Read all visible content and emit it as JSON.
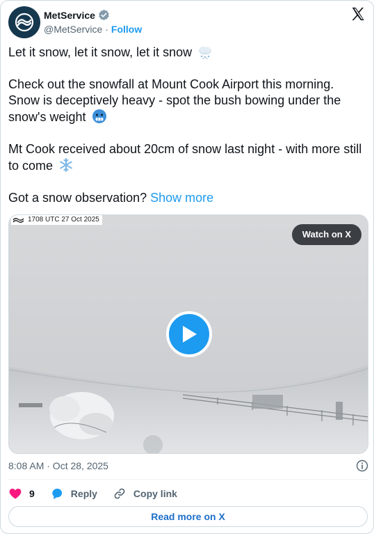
{
  "author": {
    "name": "MetService",
    "handle": "@MetService",
    "separator": "·",
    "follow_label": "Follow"
  },
  "post": {
    "line1": "Let it snow, let it snow, let it snow",
    "line2": "Check out the snowfall at Mount Cook Airport this morning. Snow is deceptively heavy - spot the bush bowing under the snow's weight",
    "line3": "Mt Cook received about 20cm of snow last night - with more still to come",
    "line4": "Got a snow observation?",
    "show_more": "Show more",
    "emojis": [
      "cloud-with-snow-icon",
      "cold-face-icon",
      "snowflake-icon"
    ]
  },
  "media": {
    "overlay_timestamp": "1708 UTC 27 Oct 2025",
    "watch_label": "Watch on X"
  },
  "meta": {
    "time": "8:08 AM · Oct 28, 2025"
  },
  "actions": {
    "likes": "9",
    "reply_label": "Reply",
    "copy_label": "Copy link"
  },
  "footer": {
    "read_more": "Read more on X"
  },
  "colors": {
    "accent": "#1d9bf0",
    "like": "#f91880",
    "text": "#0f1419",
    "muted": "#536471"
  }
}
